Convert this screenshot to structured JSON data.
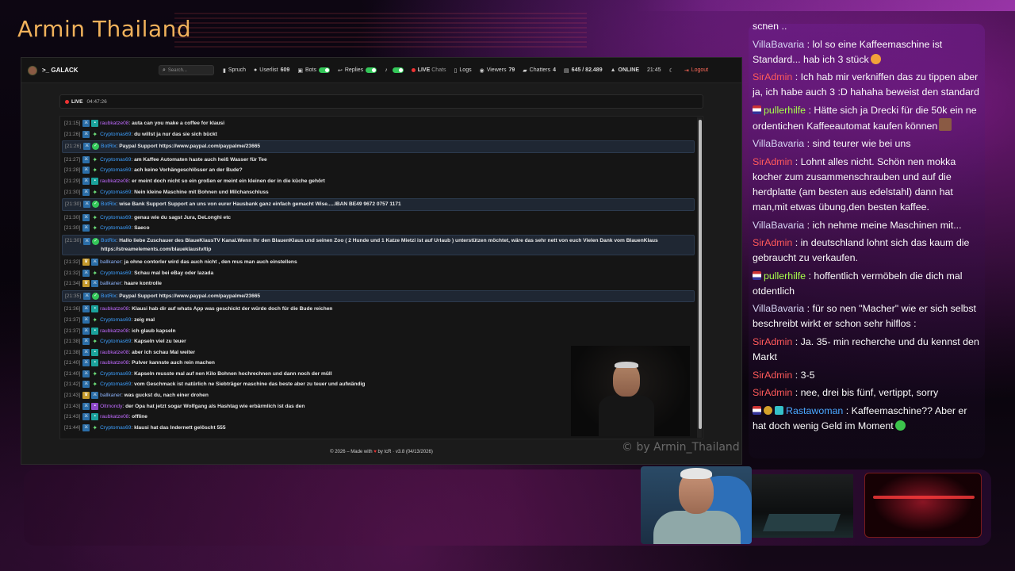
{
  "stream": {
    "title": "Armin Thailand",
    "watermark": "© by Armin_Thailand"
  },
  "app": {
    "name": ">_ GALACK",
    "search_placeholder": "Search...",
    "toolbar": {
      "spruch": "Spruch",
      "userlist": "Userlist",
      "userlist_count": "609",
      "bots": "Bots",
      "replies": "Replies",
      "live": "LIVE",
      "chats": "Chats",
      "logs": "Logs",
      "viewers": "Viewers",
      "viewers_count": "79",
      "chatters": "Chatters",
      "chatters_count": "4",
      "msgcount": "645 / 82.489",
      "online": "ONLINE",
      "clock": "21:45",
      "logout": "Logout"
    },
    "live_bar": {
      "label": "LIVE",
      "duration": "04:47:26"
    },
    "footer": {
      "left": "© 2026 – Made with",
      "right": "by tcR · v3.8 (04/13/2026)"
    },
    "colors": {
      "accent_green": "#34c759",
      "live_red": "#e33333",
      "user_blue": "#3ea0ff",
      "user_purple": "#c06bff"
    }
  },
  "chat": [
    {
      "time": "[21:15]",
      "badges": [
        "blue",
        "teal"
      ],
      "user": "raubkatze08",
      "ucolor": "purple",
      "text": "auta can you make a coffee for klausi"
    },
    {
      "time": "[21:26]",
      "badges": [
        "blue",
        "star"
      ],
      "user": "Cryptomas69",
      "ucolor": "blue",
      "text": "du willst ja nur das sie sich bückt"
    },
    {
      "time": "[21:26]",
      "badges": [
        "blue",
        "verified"
      ],
      "user": "BotRix",
      "ucolor": "bot",
      "text": "Paypal Support https://www.paypal.com/paypalme/23665",
      "hl": true
    },
    {
      "time": "[21:27]",
      "badges": [
        "blue",
        "star"
      ],
      "user": "Cryptomas69",
      "ucolor": "blue",
      "text": "am Kaffee Automaten haste auch heiß Wasser für Tee"
    },
    {
      "time": "[21:28]",
      "badges": [
        "blue",
        "star"
      ],
      "user": "Cryptomas69",
      "ucolor": "blue",
      "text": "ach keine Vorhängeschlösser an der Bude?"
    },
    {
      "time": "[21:29]",
      "badges": [
        "blue",
        "teal"
      ],
      "user": "raubkatze08",
      "ucolor": "purple",
      "text": "er meint doch nicht so ein großen er meint ein kleinen der in die küche gehört"
    },
    {
      "time": "[21:30]",
      "badges": [
        "blue",
        "star"
      ],
      "user": "Cryptomas69",
      "ucolor": "blue",
      "text": "Nein kleine Maschine mit Bohnen und Milchanschluss"
    },
    {
      "time": "[21:30]",
      "badges": [
        "blue",
        "verified"
      ],
      "user": "BotRix",
      "ucolor": "bot",
      "text": "wise Bank Support Support an uns von eurer Hausbank ganz einfach gemacht Wise.....IBAN BE49 9672 0757 1171",
      "hl": true
    },
    {
      "time": "[21:30]",
      "badges": [
        "blue",
        "star"
      ],
      "user": "Cryptomas69",
      "ucolor": "blue",
      "text": "genau wie du sagst Jura, DeLonghi etc"
    },
    {
      "time": "[21:30]",
      "badges": [
        "blue",
        "star"
      ],
      "user": "Cryptomas69",
      "ucolor": "blue",
      "text": "Saeco"
    },
    {
      "time": "[21:30]",
      "badges": [
        "blue",
        "verified"
      ],
      "user": "BotRix",
      "ucolor": "bot",
      "text": "Hallo liebe Zuschauer des BlaueKlausTV Kanal.Wenn Ihr den BlauenKlaus und seinen Zoo ( 2 Hunde und 1 Katze Mietzi ist auf Urlaub ) unterstützen möchtet, wäre das sehr nett von euch Vielen Dank vom BlauenKlaus https://streamelements.com/blaueklaustv/tip",
      "hl": true,
      "multi": true
    },
    {
      "time": "[21:32]",
      "badges": [
        "crown",
        "blue"
      ],
      "user": "ballkaner",
      "ucolor": "lightblue",
      "text": "ja ohne contorler wird das auch nicht , den mus man auch einstellens"
    },
    {
      "time": "[21:32]",
      "badges": [
        "blue",
        "star"
      ],
      "user": "Cryptomas69",
      "ucolor": "blue",
      "text": "Schau mal bei eBay oder lazada"
    },
    {
      "time": "[21:34]",
      "badges": [
        "crown",
        "blue"
      ],
      "user": "ballkaner",
      "ucolor": "lightblue",
      "text": "haare kontrolle"
    },
    {
      "time": "[21:35]",
      "badges": [
        "blue",
        "verified"
      ],
      "user": "BotRix",
      "ucolor": "bot",
      "text": "Paypal Support https://www.paypal.com/paypalme/23665",
      "hl": true
    },
    {
      "time": "[21:36]",
      "badges": [
        "blue",
        "teal"
      ],
      "user": "raubkatze08",
      "ucolor": "purple",
      "text": "Klausi hab dir auf whats App was geschickt der würde doch für die Bude reichen"
    },
    {
      "time": "[21:37]",
      "badges": [
        "blue",
        "star"
      ],
      "user": "Cryptomas69",
      "ucolor": "blue",
      "text": "zeig mal"
    },
    {
      "time": "[21:37]",
      "badges": [
        "blue",
        "teal"
      ],
      "user": "raubkatze08",
      "ucolor": "purple",
      "text": "ich glaub kapseln"
    },
    {
      "time": "[21:38]",
      "badges": [
        "blue",
        "star"
      ],
      "user": "Cryptomas69",
      "ucolor": "blue",
      "text": "Kapseln viel zu teuer"
    },
    {
      "time": "[21:38]",
      "badges": [
        "blue",
        "teal"
      ],
      "user": "raubkatze08",
      "ucolor": "purple",
      "text": "aber ich schau Mal weiter"
    },
    {
      "time": "[21:40]",
      "badges": [
        "blue",
        "teal"
      ],
      "user": "raubkatze08",
      "ucolor": "purple",
      "text": "Pulver kannste auch rein machen"
    },
    {
      "time": "[21:40]",
      "badges": [
        "blue",
        "star"
      ],
      "user": "Cryptomas69",
      "ucolor": "blue",
      "text": "Kapseln musste mal auf nen Kilo Bohnen hochrechnen und dann noch der müll"
    },
    {
      "time": "[21:42]",
      "badges": [
        "blue",
        "star"
      ],
      "user": "Cryptomas69",
      "ucolor": "blue",
      "text": "vom Geschmack ist natürlich ne Siebträger maschine das beste aber zu teuer und aufwändig"
    },
    {
      "time": "[21:43]",
      "badges": [
        "crown",
        "blue"
      ],
      "user": "ballkaner",
      "ucolor": "lightblue",
      "text": "was guckst du, nach einer drohen"
    },
    {
      "time": "[21:43]",
      "badges": [
        "blue",
        "purple"
      ],
      "user": "Oltmondy",
      "ucolor": "purple",
      "text": "der Opa hat jetzt sogar Wolfgang als Hashtag wie erbärmlich ist das den"
    },
    {
      "time": "[21:43]",
      "badges": [
        "blue",
        "teal"
      ],
      "user": "raubkatze08",
      "ucolor": "purple",
      "text": "offline"
    },
    {
      "time": "[21:44]",
      "badges": [
        "blue",
        "star"
      ],
      "user": "Cryptomas69",
      "ucolor": "blue",
      "text": "klausi hat das Indernett gelöscht 555"
    }
  ],
  "overlay_chat": [
    {
      "user": "",
      "text": "schen ..",
      "color": "villa"
    },
    {
      "user": "VillaBavaria",
      "text": ": lol so eine Kaffeemaschine ist Standard... hab ich 3 stück",
      "color": "villa",
      "emoji": "orange"
    },
    {
      "user": "SirAdmin",
      "text": ": Ich hab mir verkniffen das zu tippen aber ja, ich habe auch 3 :D hahaha beweist den standard",
      "color": "sir"
    },
    {
      "user": "pullerhilfe",
      "text": ": Hätte sich ja Drecki für die 50k ein ne ordentichen Kaffeeautomat kaufen können",
      "color": "puller",
      "badges": [
        "flag"
      ],
      "emoji": "face"
    },
    {
      "user": "VillaBavaria",
      "text": ": sind teurer wie bei uns",
      "color": "villa"
    },
    {
      "user": "SirAdmin",
      "text": ": Lohnt alles nicht. Schön nen mokka kocher zum zusammenschrauben und auf die herdplatte (am besten aus edelstahl) dann hat man,mit etwas übung,den besten kaffee.",
      "color": "sir"
    },
    {
      "user": "VillaBavaria",
      "text": ": ich nehme meine Maschinen mit...",
      "color": "villa"
    },
    {
      "user": "SirAdmin",
      "text": ": in deutschland lohnt sich das kaum die gebraucht zu verkaufen.",
      "color": "sir"
    },
    {
      "user": "pullerhilfe",
      "text": ": hoffentlich vermöbeln die dich mal otdentlich",
      "color": "puller",
      "badges": [
        "flag"
      ]
    },
    {
      "user": "VillaBavaria",
      "text": ": für so nen \"Macher\" wie er sich selbst beschreibt wirkt er schon sehr hilflos :",
      "color": "villa"
    },
    {
      "user": "SirAdmin",
      "text": ": Ja. 35- min recherche und du kennst den Markt",
      "color": "sir"
    },
    {
      "user": "SirAdmin",
      "text": ": 3-5",
      "color": "sir"
    },
    {
      "user": "SirAdmin",
      "text": ": nee, drei bis fünf, vertippt, sorry",
      "color": "sir"
    },
    {
      "user": "Rastawoman",
      "text": ": Kaffeemaschine?? Aber er hat doch wenig Geld im Moment",
      "color": "rasta",
      "badges": [
        "flag",
        "gold",
        "cyan"
      ],
      "emoji": "green"
    }
  ]
}
